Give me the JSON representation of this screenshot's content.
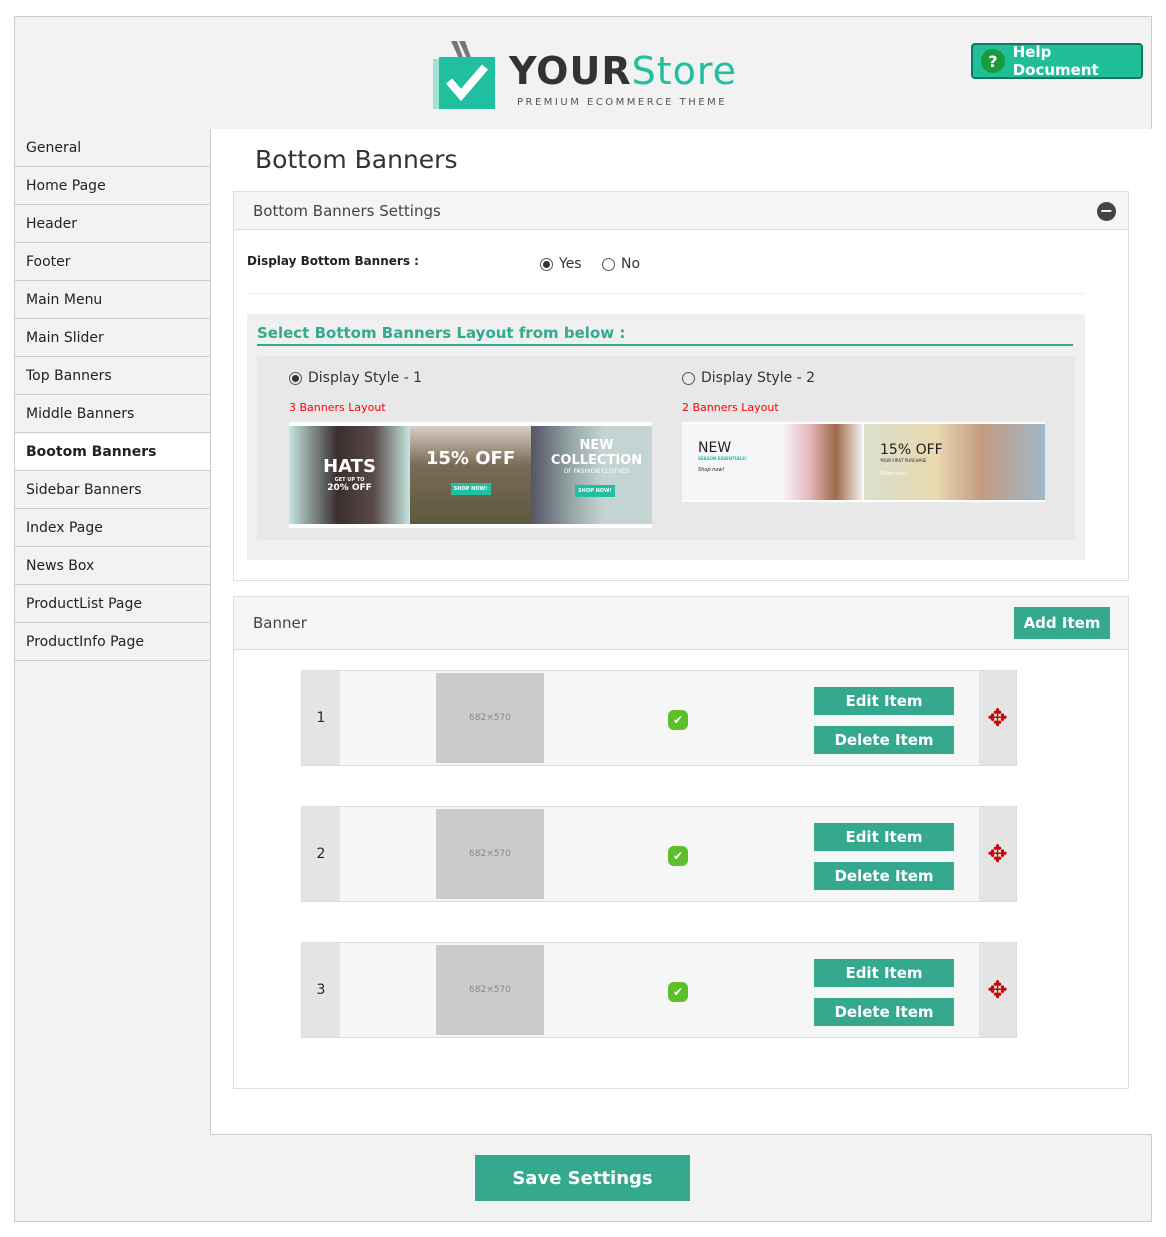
{
  "header": {
    "brand_main": "YOUR",
    "brand_accent": "Store",
    "tagline": "PREMIUM ECOMMERCE THEME",
    "help_label": "Help Document"
  },
  "sidebar": {
    "items": [
      {
        "label": "General"
      },
      {
        "label": "Home Page"
      },
      {
        "label": "Header"
      },
      {
        "label": "Footer"
      },
      {
        "label": "Main Menu"
      },
      {
        "label": "Main Slider"
      },
      {
        "label": "Top Banners"
      },
      {
        "label": "Middle Banners"
      },
      {
        "label": "Bootom Banners",
        "active": true
      },
      {
        "label": "Sidebar Banners"
      },
      {
        "label": "Index Page"
      },
      {
        "label": "News Box"
      },
      {
        "label": "ProductList Page"
      },
      {
        "label": "ProductInfo Page"
      }
    ]
  },
  "page_title": "Bottom Banners",
  "settings": {
    "title": "Bottom Banners Settings",
    "display_label": "Display Bottom Banners :",
    "yes": "Yes",
    "no": "No",
    "selected": "Yes",
    "layout_heading": "Select Bottom Banners Layout from below :",
    "styles": [
      {
        "label": "Display Style - 1",
        "caption": "3 Banners Layout",
        "selected": true,
        "banners": [
          {
            "title": "HATS",
            "sub": "GET UP TO",
            "extra": "20% OFF"
          },
          {
            "title": "15% OFF",
            "sub": "",
            "extra": "SHOP NOW!"
          },
          {
            "title": "NEW COLLECTION",
            "sub": "OF FASHION CLOTHES",
            "extra": "SHOP NOW!"
          }
        ]
      },
      {
        "label": "Display Style - 2",
        "caption": "2 Banners Layout",
        "selected": false,
        "banners": [
          {
            "title": "NEW",
            "sub": "SEASON ESSENTIALS!",
            "extra": "Shop now!"
          },
          {
            "title": "15% OFF",
            "sub": "YOUR FIRST PURCHASE",
            "extra": "Shop now!"
          }
        ]
      }
    ]
  },
  "banner": {
    "title": "Banner",
    "add_label": "Add Item",
    "rows": [
      {
        "num": "1",
        "thumb": "682×570"
      },
      {
        "num": "2",
        "thumb": "682×570"
      },
      {
        "num": "3",
        "thumb": "682×570"
      }
    ],
    "edit_label": "Edit Item",
    "delete_label": "Delete Item"
  },
  "save_label": "Save Settings",
  "colors": {
    "accent": "#34a98e",
    "brand": "#20bf9f",
    "caption": "#ff0000"
  }
}
